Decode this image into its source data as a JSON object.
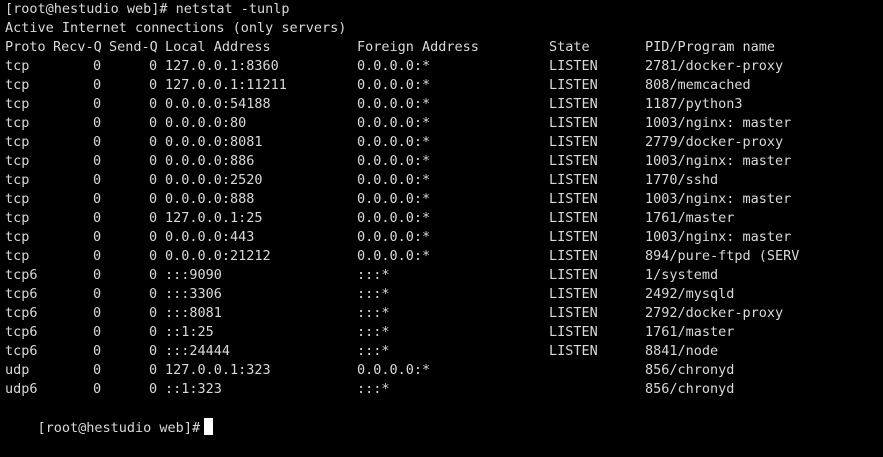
{
  "terminal": {
    "command_line": "[root@hestudio web]# netstat -tunlp",
    "subtitle": "Active Internet connections (only servers)",
    "headers": {
      "proto": "Proto",
      "recvq": "Recv-Q",
      "sendq": "Send-Q",
      "local": "Local Address",
      "foreign": "Foreign Address",
      "state": "State",
      "pid": "PID/Program name"
    },
    "rows": [
      {
        "proto": "tcp",
        "recvq": "0",
        "sendq": "0",
        "local": "127.0.0.1:8360",
        "foreign": "0.0.0.0:*",
        "state": "LISTEN",
        "pid": "2781/docker-proxy"
      },
      {
        "proto": "tcp",
        "recvq": "0",
        "sendq": "0",
        "local": "127.0.0.1:11211",
        "foreign": "0.0.0.0:*",
        "state": "LISTEN",
        "pid": "808/memcached"
      },
      {
        "proto": "tcp",
        "recvq": "0",
        "sendq": "0",
        "local": "0.0.0.0:54188",
        "foreign": "0.0.0.0:*",
        "state": "LISTEN",
        "pid": "1187/python3"
      },
      {
        "proto": "tcp",
        "recvq": "0",
        "sendq": "0",
        "local": "0.0.0.0:80",
        "foreign": "0.0.0.0:*",
        "state": "LISTEN",
        "pid": "1003/nginx: master"
      },
      {
        "proto": "tcp",
        "recvq": "0",
        "sendq": "0",
        "local": "0.0.0.0:8081",
        "foreign": "0.0.0.0:*",
        "state": "LISTEN",
        "pid": "2779/docker-proxy"
      },
      {
        "proto": "tcp",
        "recvq": "0",
        "sendq": "0",
        "local": "0.0.0.0:886",
        "foreign": "0.0.0.0:*",
        "state": "LISTEN",
        "pid": "1003/nginx: master"
      },
      {
        "proto": "tcp",
        "recvq": "0",
        "sendq": "0",
        "local": "0.0.0.0:2520",
        "foreign": "0.0.0.0:*",
        "state": "LISTEN",
        "pid": "1770/sshd"
      },
      {
        "proto": "tcp",
        "recvq": "0",
        "sendq": "0",
        "local": "0.0.0.0:888",
        "foreign": "0.0.0.0:*",
        "state": "LISTEN",
        "pid": "1003/nginx: master"
      },
      {
        "proto": "tcp",
        "recvq": "0",
        "sendq": "0",
        "local": "127.0.0.1:25",
        "foreign": "0.0.0.0:*",
        "state": "LISTEN",
        "pid": "1761/master"
      },
      {
        "proto": "tcp",
        "recvq": "0",
        "sendq": "0",
        "local": "0.0.0.0:443",
        "foreign": "0.0.0.0:*",
        "state": "LISTEN",
        "pid": "1003/nginx: master"
      },
      {
        "proto": "tcp",
        "recvq": "0",
        "sendq": "0",
        "local": "0.0.0.0:21212",
        "foreign": "0.0.0.0:*",
        "state": "LISTEN",
        "pid": "894/pure-ftpd (SERV"
      },
      {
        "proto": "tcp6",
        "recvq": "0",
        "sendq": "0",
        "local": ":::9090",
        "foreign": ":::*",
        "state": "LISTEN",
        "pid": "1/systemd"
      },
      {
        "proto": "tcp6",
        "recvq": "0",
        "sendq": "0",
        "local": ":::3306",
        "foreign": ":::*",
        "state": "LISTEN",
        "pid": "2492/mysqld"
      },
      {
        "proto": "tcp6",
        "recvq": "0",
        "sendq": "0",
        "local": ":::8081",
        "foreign": ":::*",
        "state": "LISTEN",
        "pid": "2792/docker-proxy"
      },
      {
        "proto": "tcp6",
        "recvq": "0",
        "sendq": "0",
        "local": "::1:25",
        "foreign": ":::*",
        "state": "LISTEN",
        "pid": "1761/master"
      },
      {
        "proto": "tcp6",
        "recvq": "0",
        "sendq": "0",
        "local": ":::24444",
        "foreign": ":::*",
        "state": "LISTEN",
        "pid": "8841/node"
      },
      {
        "proto": "udp",
        "recvq": "0",
        "sendq": "0",
        "local": "127.0.0.1:323",
        "foreign": "0.0.0.0:*",
        "state": "",
        "pid": "856/chronyd"
      },
      {
        "proto": "udp6",
        "recvq": "0",
        "sendq": "0",
        "local": "::1:323",
        "foreign": ":::*",
        "state": "",
        "pid": "856/chronyd"
      }
    ],
    "prompt": "[root@hestudio web]#",
    "colors": {
      "background": "#000000",
      "text": "#d9d9d9",
      "cursor": "#ffffff"
    }
  }
}
